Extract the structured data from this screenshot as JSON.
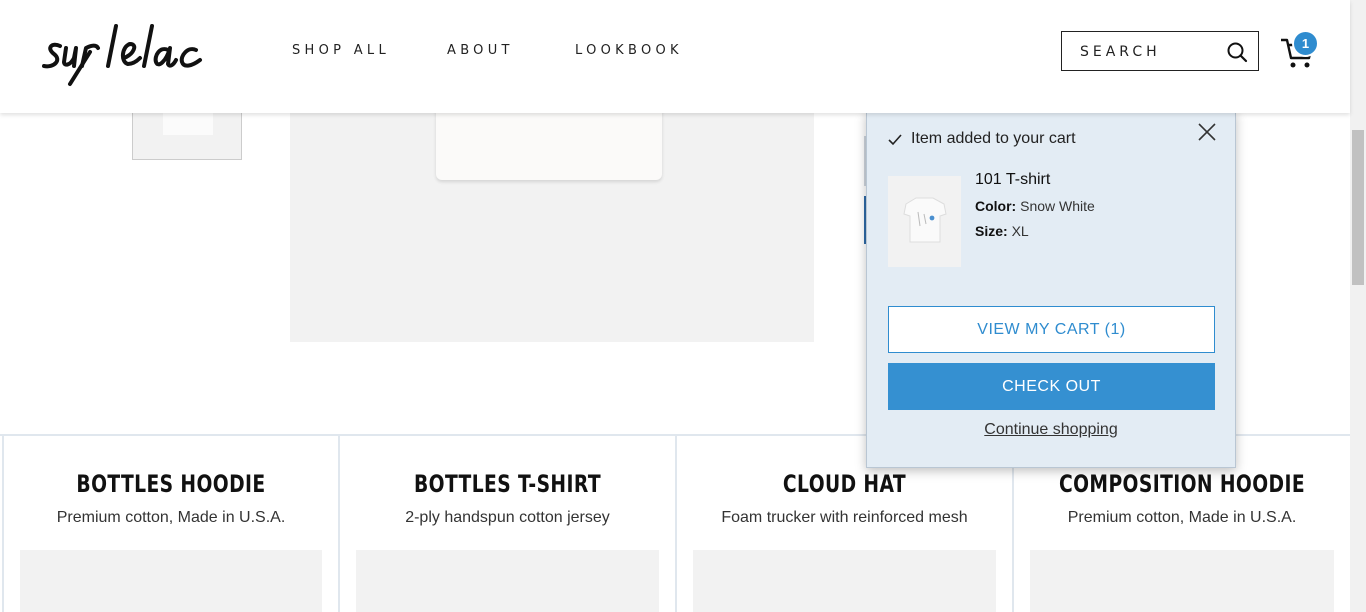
{
  "brand": {
    "logo_text": "sur le lac"
  },
  "nav": {
    "items": [
      "SHOP ALL",
      "ABOUT",
      "LOOKBOOK"
    ]
  },
  "search": {
    "placeholder": "SEARCH"
  },
  "cart": {
    "count": "1"
  },
  "popup": {
    "added_text": "Item added to your cart",
    "product_name": "101 T-shirt",
    "color_label": "Color:",
    "color_value": "Snow White",
    "size_label": "Size:",
    "size_value": "XL",
    "view_cart_label": "VIEW MY CART (1)",
    "checkout_label": "CHECK OUT",
    "continue_label": "Continue shopping"
  },
  "products": [
    {
      "title": "BOTTLES HOODIE",
      "desc": "Premium cotton, Made in U.S.A."
    },
    {
      "title": "BOTTLES T-SHIRT",
      "desc": "2-ply handspun cotton jersey"
    },
    {
      "title": "CLOUD HAT",
      "desc": "Foam trucker with reinforced mesh"
    },
    {
      "title": "COMPOSITION HOODIE",
      "desc": "Premium cotton, Made in U.S.A."
    }
  ],
  "colors": {
    "accent": "#2f8ccf",
    "popup_bg": "#e3ecf4"
  }
}
